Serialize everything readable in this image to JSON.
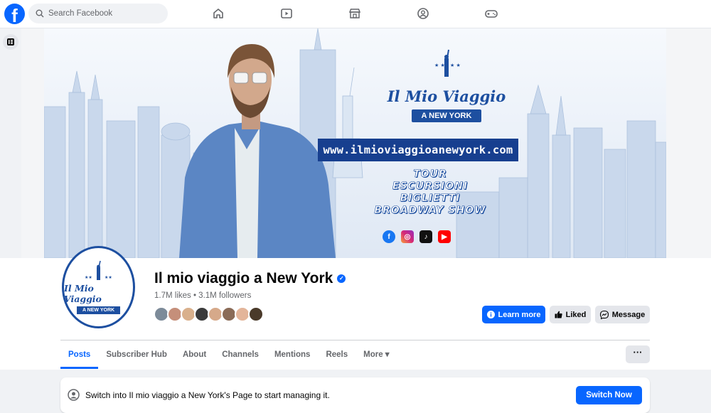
{
  "topbar": {
    "logo": "f",
    "search_placeholder": "Search Facebook",
    "nav_icons": [
      "home-icon",
      "video-icon",
      "marketplace-icon",
      "groups-icon",
      "gaming-icon"
    ]
  },
  "cover": {
    "brand_title": "Il Mio Viaggio",
    "brand_ribbon": "A NEW YORK",
    "url": "www.ilmioviaggioanewyork.com",
    "taglines": [
      "TOUR",
      "ESCURSIONI",
      "BIGLIETTI",
      "BROADWAY SHOW"
    ],
    "socials": [
      "facebook-icon",
      "instagram-icon",
      "tiktok-icon",
      "youtube-icon"
    ]
  },
  "avatar": {
    "title": "Il Mio Viaggio",
    "ribbon": "A NEW YORK"
  },
  "page": {
    "name": "Il mio viaggio a New York",
    "stats": "1.7M likes • 3.1M followers"
  },
  "actions": {
    "learn_more": "Learn more",
    "liked": "Liked",
    "message": "Message",
    "more_dots": "···"
  },
  "tabs": [
    {
      "label": "Posts",
      "active": true
    },
    {
      "label": "Subscriber Hub"
    },
    {
      "label": "About"
    },
    {
      "label": "Channels"
    },
    {
      "label": "Mentions"
    },
    {
      "label": "Reels"
    },
    {
      "label": "More ▾"
    }
  ],
  "switch_banner": {
    "text": "Switch into Il mio viaggio a New York's Page to start managing it.",
    "button": "Switch Now"
  },
  "colors": {
    "accent": "#0866ff",
    "brand_blue": "#1d4fa0"
  }
}
